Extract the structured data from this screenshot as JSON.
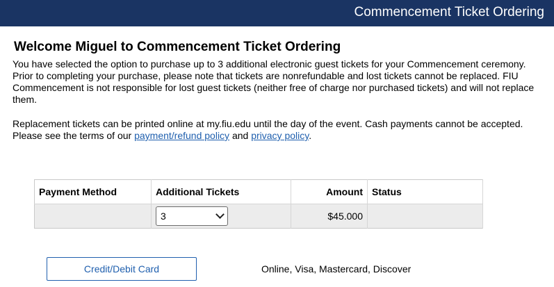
{
  "header": {
    "title": "Commencement Ticket Ordering"
  },
  "main": {
    "heading": "Welcome Miguel to Commencement Ticket Ordering",
    "paragraph1": "You have selected the option to purchase up to 3 additional electronic guest tickets for your Commencement ceremony. Prior to completing your purchase, please note that tickets are nonrefundable and lost tickets cannot be replaced. FIU Commencement is not responsible for lost guest tickets (neither free of charge nor purchased tickets) and will not replace them.",
    "paragraph2_a": "Replacement tickets can be printed online at my.fiu.edu until the day of the event. Cash payments cannot be accepted. Please see the terms of our ",
    "link_refund": "payment/refund policy",
    "paragraph2_b": " and ",
    "link_privacy": "privacy policy",
    "paragraph2_c": "."
  },
  "table": {
    "headers": [
      "Payment Method",
      "Additional Tickets",
      "Amount",
      "Status"
    ],
    "row": {
      "payment_method": "",
      "tickets_selected": "3",
      "amount": "$45.000",
      "status": ""
    }
  },
  "payment": {
    "button_label": "Credit/Debit Card",
    "methods_text": "Online, Visa, Mastercard, Discover"
  },
  "colors": {
    "header_bg": "#1a3463",
    "link": "#1f5fae"
  }
}
